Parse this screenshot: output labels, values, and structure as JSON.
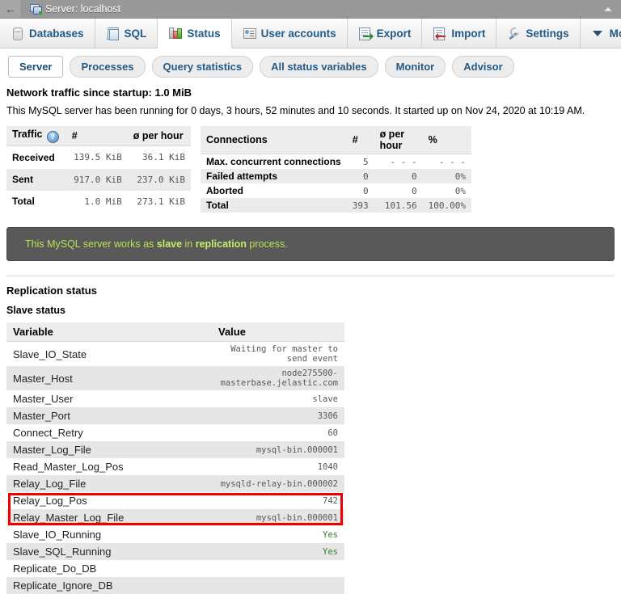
{
  "titlebar": {
    "back_icon": "back-arrow-icon",
    "server_icon": "server-icon",
    "title": "Server: localhost",
    "collapse_icon": "collapse-up-icon"
  },
  "main_tabs": [
    {
      "label": "Databases",
      "icon": "database-icon",
      "active": false
    },
    {
      "label": "SQL",
      "icon": "sql-page-icon",
      "active": false
    },
    {
      "label": "Status",
      "icon": "status-bars-icon",
      "active": true
    },
    {
      "label": "User accounts",
      "icon": "user-card-icon",
      "active": false
    },
    {
      "label": "Export",
      "icon": "export-icon",
      "active": false
    },
    {
      "label": "Import",
      "icon": "import-icon",
      "active": false
    },
    {
      "label": "Settings",
      "icon": "wrench-icon",
      "active": false
    },
    {
      "label": "More",
      "icon": "chevron-down-icon",
      "active": false
    }
  ],
  "sub_tabs": [
    {
      "label": "Server",
      "active": true
    },
    {
      "label": "Processes",
      "active": false
    },
    {
      "label": "Query statistics",
      "active": false
    },
    {
      "label": "All status variables",
      "active": false
    },
    {
      "label": "Monitor",
      "active": false
    },
    {
      "label": "Advisor",
      "active": false
    }
  ],
  "network_traffic_line": "Network traffic since startup: 1.0 MiB",
  "uptime_line": "This MySQL server has been running for 0 days, 3 hours, 52 minutes and 10 seconds. It started up on Nov 24, 2020 at 10:19 AM.",
  "traffic_table": {
    "headers": [
      "Traffic",
      "#",
      "ø per hour"
    ],
    "help_icon": "help-question-icon",
    "rows": [
      {
        "label": "Received",
        "count": "139.5 KiB",
        "per_hour": "36.1 KiB"
      },
      {
        "label": "Sent",
        "count": "917.0 KiB",
        "per_hour": "237.0 KiB"
      },
      {
        "label": "Total",
        "count": "1.0 MiB",
        "per_hour": "273.1 KiB"
      }
    ]
  },
  "connections_table": {
    "headers": [
      "Connections",
      "#",
      "ø per hour",
      "%"
    ],
    "rows": [
      {
        "label": "Max. concurrent connections",
        "count": "5",
        "per_hour": "- - -",
        "pct": "- - -"
      },
      {
        "label": "Failed attempts",
        "count": "0",
        "per_hour": "0",
        "pct": "0%"
      },
      {
        "label": "Aborted",
        "count": "0",
        "per_hour": "0",
        "pct": "0%"
      },
      {
        "label": "Total",
        "count": "393",
        "per_hour": "101.56",
        "pct": "100.00%"
      }
    ]
  },
  "notice": {
    "text_before": "This MySQL server works as ",
    "bold_1": "slave",
    "text_middle": " in ",
    "bold_2": "replication",
    "text_after": " process.",
    "background_color": "#595959",
    "text_color": "#b7e24f"
  },
  "replication": {
    "section_title": "Replication status",
    "subsection_title": "Slave status",
    "headers": [
      "Variable",
      "Value"
    ],
    "rows": [
      {
        "variable": "Slave_IO_State",
        "value": "Waiting for master to send event",
        "highlight": false
      },
      {
        "variable": "Master_Host",
        "value": "node275500-masterbase.jelastic.com",
        "highlight": false
      },
      {
        "variable": "Master_User",
        "value": "slave",
        "highlight": false
      },
      {
        "variable": "Master_Port",
        "value": "3306",
        "highlight": false
      },
      {
        "variable": "Connect_Retry",
        "value": "60",
        "highlight": false
      },
      {
        "variable": "Master_Log_File",
        "value": "mysql-bin.000001",
        "highlight": false
      },
      {
        "variable": "Read_Master_Log_Pos",
        "value": "1040",
        "highlight": false
      },
      {
        "variable": "Relay_Log_File",
        "value": "mysqld-relay-bin.000002",
        "highlight": false
      },
      {
        "variable": "Relay_Log_Pos",
        "value": "742",
        "highlight": false
      },
      {
        "variable": "Relay_Master_Log_File",
        "value": "mysql-bin.000001",
        "highlight": false
      },
      {
        "variable": "Slave_IO_Running",
        "value": "Yes",
        "highlight": true
      },
      {
        "variable": "Slave_SQL_Running",
        "value": "Yes",
        "highlight": true
      },
      {
        "variable": "Replicate_Do_DB",
        "value": "",
        "highlight": false
      },
      {
        "variable": "Replicate_Ignore_DB",
        "value": "",
        "highlight": false
      }
    ],
    "annotation_color": "#ee0000",
    "yes_color": "#2f7d32"
  }
}
